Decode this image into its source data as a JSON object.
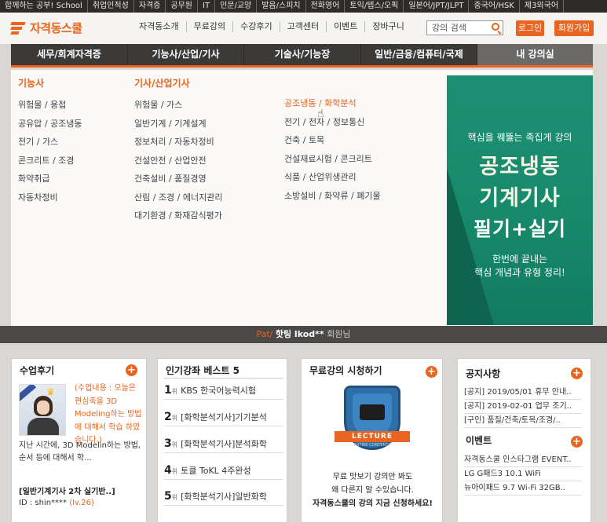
{
  "topbar": {
    "items": [
      "합께하는 공부!",
      "취업인적성",
      "자격증",
      "공무원",
      "IT",
      "인문/교양",
      "발음/스피치",
      "전화영어",
      "토익/텝스/오픽",
      "일본어/JPT/JLPT",
      "중국어/HSK",
      "제3외국어"
    ],
    "school_label": "School"
  },
  "header": {
    "logo_text": "자격동스쿨",
    "nav": [
      "자격동소개",
      "무료강의",
      "수강후기",
      "고객센터",
      "이벤트",
      "장바구니"
    ],
    "search_placeholder": "강의 검색",
    "login_label": "로그인",
    "join_label": "회원가입"
  },
  "main_nav": {
    "items": [
      "세무/회계자격증",
      "기능사/산업/기사",
      "기술사/기능장",
      "일반/금융/컴퓨터/국제",
      "내 강의실"
    ],
    "selected_index": 4
  },
  "mega_menu": {
    "col1": {
      "heading": "기능사",
      "items": [
        "위험물 / 용접",
        "공유압 / 공조냉동",
        "전기 / 가스",
        "콘크리트 / 조경",
        "화약취급",
        "자동차정비"
      ]
    },
    "col2": {
      "heading": "기사/산업기사",
      "items": [
        "위험물 / 가스",
        "일반기계 / 기계설계",
        "정보처리 / 자동차정비",
        "건설안전 / 산업안전",
        "건축설비 / 품질경영",
        "산림 / 조경 / 에너지관리",
        "대기환경 / 화재감식평가"
      ]
    },
    "col3": {
      "items": [
        "공조냉동 / 화학분석",
        "전기 / 전자 / 정보통신",
        "건축 / 토목",
        "건설재료시험 / 콘크리트",
        "식품 / 산업위생관리",
        "소방설비 / 화약류 / 폐기물"
      ],
      "active_index": 0
    },
    "banner": {
      "subtitle": "핵심을 꿰뚫는 족집게 강의",
      "line1": "공조냉동",
      "line2": "기계기사",
      "line3": "필기+실기",
      "note1": "한번에 끝내는",
      "note2": "핵심 개념과 유형 정리!",
      "color": "#178a6c"
    }
  },
  "welcome": {
    "pat": "Pat",
    "name": "핫팅 lkod**",
    "suffix": "회원님"
  },
  "review_box": {
    "title": "수업후기",
    "text_orange": "(수업내용 : 오늘은 편심축을 3D Modeling하는 방법에 대해서 학습 하였습니다.)",
    "text_rest": "지난 시간에, 3D Modelin하는 방법, 순서 등에 대해서 학...",
    "course": "[일반기계기사 2차 실기반..]",
    "id_label": "ID : shin****",
    "level": "(lv.26)"
  },
  "popular_box": {
    "title": "인기강좌 베스트 5",
    "rank_suffix": "위",
    "items": [
      {
        "rank": "1",
        "label": "KBS 한국어능력시험"
      },
      {
        "rank": "2",
        "label": "[화학분석기사]기기분석"
      },
      {
        "rank": "3",
        "label": "[화학분석기사]분석화학"
      },
      {
        "rank": "4",
        "label": "토클 ToKL 4주완성"
      },
      {
        "rank": "5",
        "label": "[화학분석기사]일반화학"
      }
    ]
  },
  "free_box": {
    "title": "무료강의 시청하기",
    "ribbon": "LECTURE",
    "ribbon_sub": "ENTIRE CONTENTS",
    "line1": "무료 맛보기 강의만 봐도",
    "line2": "왜 다른지 알 수있습니다.",
    "line3": "자격동스쿨의 강의 지금 신청하세요!"
  },
  "notice_box": {
    "title": "공지사항",
    "items": [
      "[공지] 2019/05/01 휴무 안내..",
      "[공지] 2019-02-01 업무 조기..",
      "[구인] 품질/건축/토목/조경/.."
    ],
    "event_title": "이벤트",
    "events": [
      "자격동스쿨 인스타그램 EVENT..",
      "LG G패드3 10.1 WiFi",
      "뉴아이패드 9.7 Wi-Fi 32GB.."
    ]
  },
  "colors": {
    "accent": "#e8641f",
    "dark": "#3b3a39"
  }
}
